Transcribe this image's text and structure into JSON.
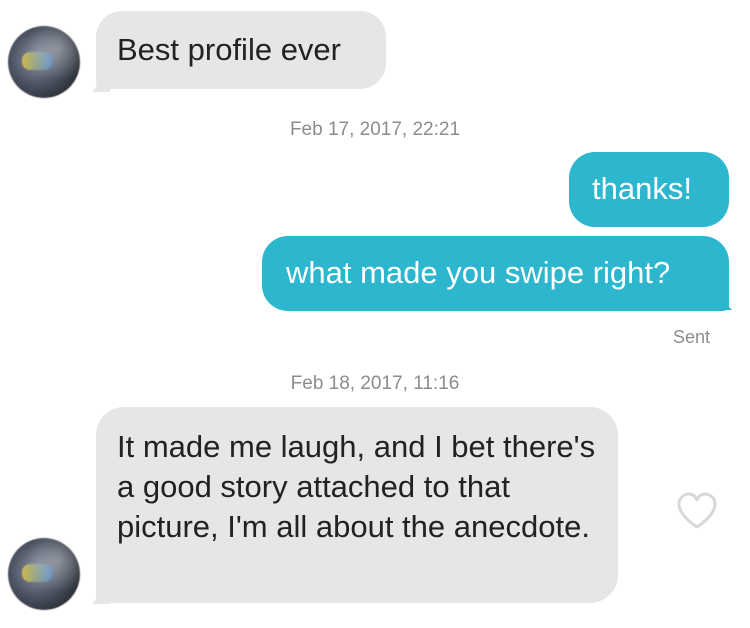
{
  "messages": [
    {
      "sender": "match",
      "text": "Best profile ever"
    },
    {
      "sender": "me",
      "text": "thanks!"
    },
    {
      "sender": "me",
      "text": "what made you swipe right?"
    },
    {
      "sender": "match",
      "text": "It made me laugh, and I bet there's a good story attached to that picture, I'm all about the anecdote."
    }
  ],
  "timestamps": [
    "Feb 17, 2017, 22:21",
    "Feb 18, 2017, 11:16"
  ],
  "status": {
    "sent_label": "Sent"
  },
  "icons": {
    "avatar": "user-avatar",
    "like": "heart-outline-icon"
  },
  "colors": {
    "incoming_bubble": "#e6e6e8",
    "outgoing_bubble": "#2db7cf",
    "timestamp_text": "#8c8c8f"
  }
}
